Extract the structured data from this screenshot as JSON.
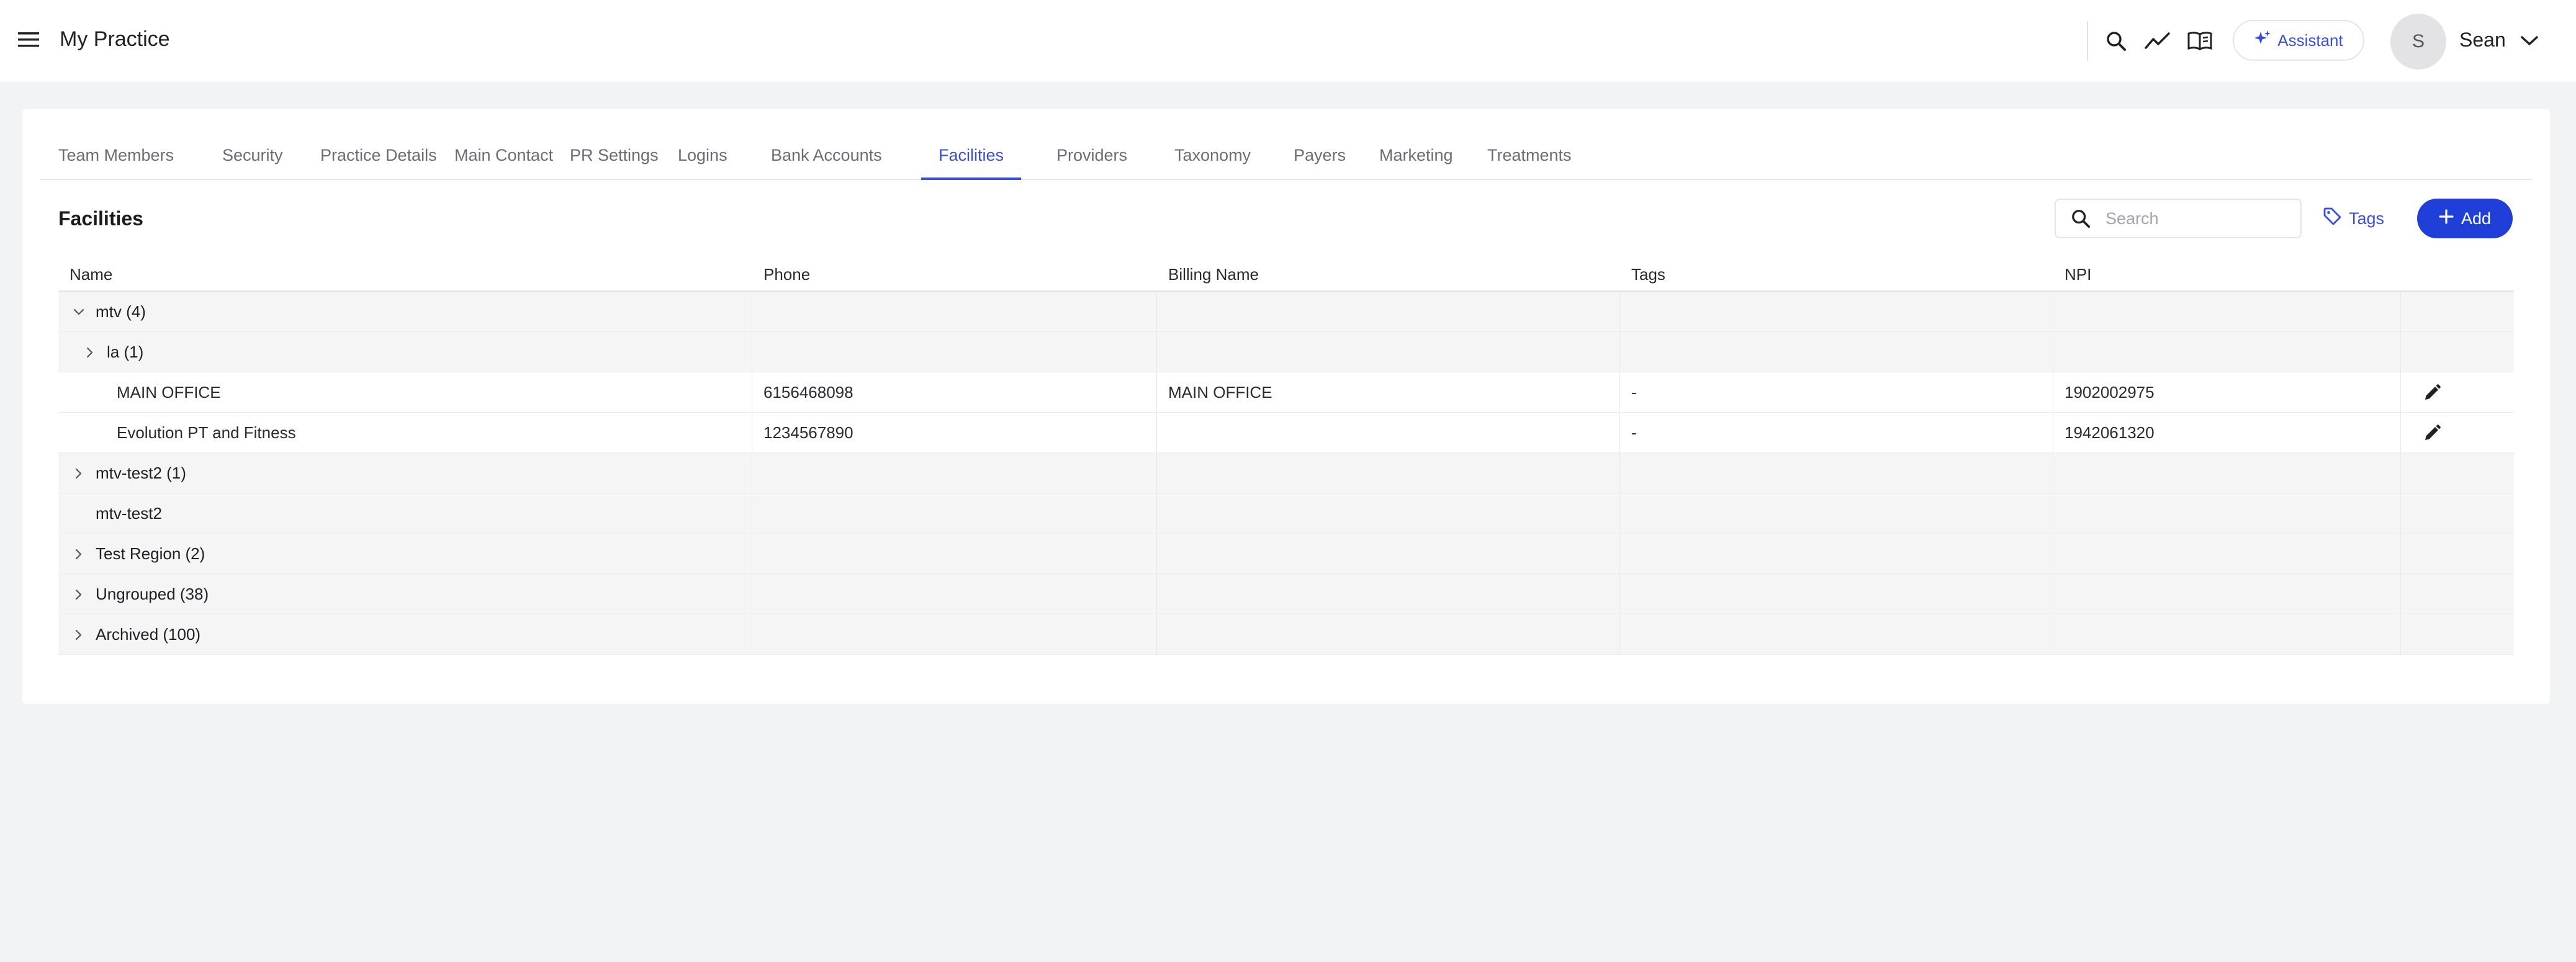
{
  "app": {
    "title": "My Practice"
  },
  "header": {
    "assistant_label": "Assistant",
    "avatar_initial": "S",
    "user_name": "Sean",
    "accent_color": "#3b4fd6"
  },
  "tabs": [
    {
      "label": "Team Members"
    },
    {
      "label": "Security"
    },
    {
      "label": "Practice Details"
    },
    {
      "label": "Main Contact"
    },
    {
      "label": "PR Settings"
    },
    {
      "label": "Logins"
    },
    {
      "label": "Bank Accounts"
    },
    {
      "label": "Facilities"
    },
    {
      "label": "Providers"
    },
    {
      "label": "Taxonomy"
    },
    {
      "label": "Payers"
    },
    {
      "label": "Marketing"
    },
    {
      "label": "Treatments"
    }
  ],
  "active_tab": "Facilities",
  "section": {
    "title": "Facilities",
    "search_placeholder": "Search",
    "tags_label": "Tags",
    "add_label": "Add"
  },
  "table": {
    "columns": [
      "Name",
      "Phone",
      "Billing Name",
      "Tags",
      "NPI"
    ],
    "rows": [
      {
        "name": "mtv (4)",
        "kind": "group",
        "expanded": true,
        "level": 0
      },
      {
        "name": "la (1)",
        "kind": "group",
        "expanded": false,
        "level": 1
      },
      {
        "name": "MAIN OFFICE",
        "kind": "item",
        "phone": "6156468098",
        "billing": "MAIN OFFICE",
        "tags": "-",
        "npi": "1902002975"
      },
      {
        "name": "Evolution PT and Fitness",
        "kind": "item",
        "phone": "1234567890",
        "billing": "",
        "tags": "-",
        "npi": "1942061320"
      },
      {
        "name": "mtv-test2 (1)",
        "kind": "group",
        "expanded": false,
        "level": 0
      },
      {
        "name": "mtv-test2",
        "kind": "group-plain",
        "level": 0
      },
      {
        "name": "Test Region (2)",
        "kind": "group",
        "expanded": false,
        "level": 0
      },
      {
        "name": "Ungrouped (38)",
        "kind": "group",
        "expanded": false,
        "level": 0
      },
      {
        "name": "Archived (100)",
        "kind": "group",
        "expanded": false,
        "level": 0
      }
    ]
  }
}
